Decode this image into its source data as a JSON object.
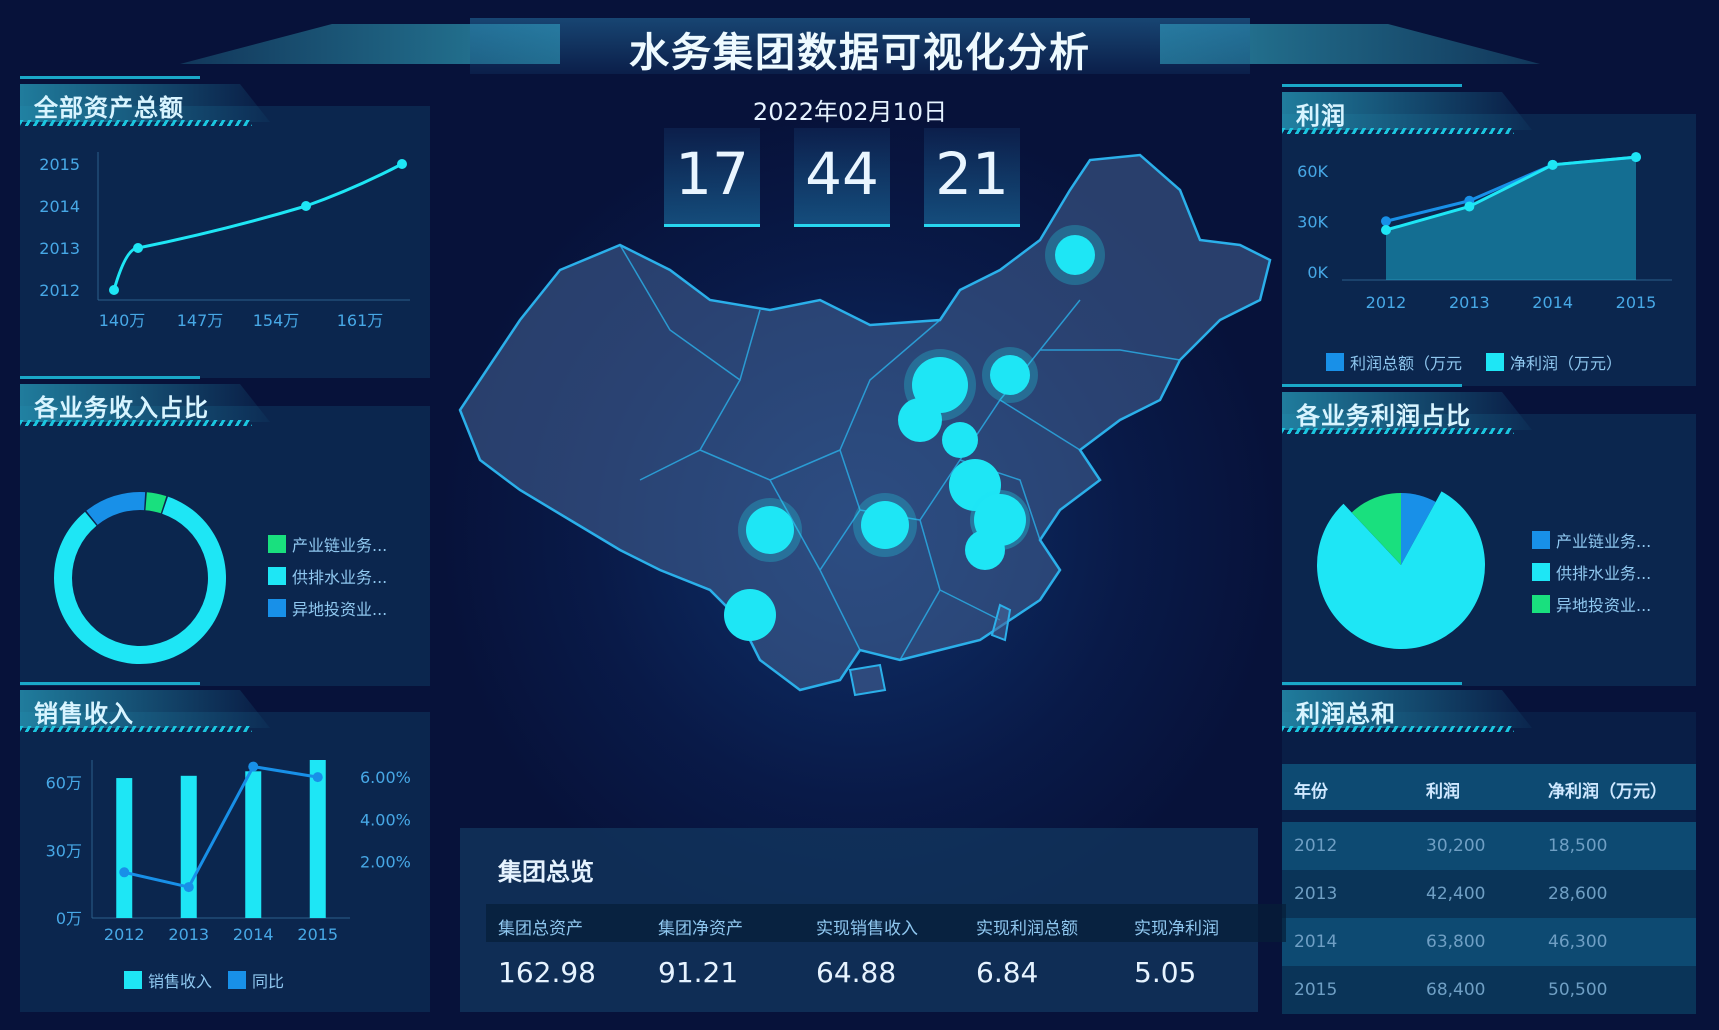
{
  "header": {
    "title": "水务集团数据可视化分析"
  },
  "datetime": {
    "date": "2022年02月10日",
    "hour": "17",
    "minute": "44",
    "second": "21"
  },
  "colors": {
    "bg": "#07123a",
    "cyan": "#1ee6f5",
    "blue": "#1890e8",
    "green": "#19e07e"
  },
  "assets": {
    "title": "全部资产总额",
    "chart_data": {
      "type": "line",
      "x_ticks": [
        "140万",
        "147万",
        "154万",
        "161万"
      ],
      "y_ticks": [
        "2015",
        "2014",
        "2013",
        "2012"
      ],
      "points": [
        {
          "x": 140,
          "y": 2012
        },
        {
          "x": 142,
          "y": 2013
        },
        {
          "x": 156,
          "y": 2014
        },
        {
          "x": 164,
          "y": 2015
        }
      ]
    }
  },
  "income_share": {
    "title": "各业务收入占比",
    "chart_data": {
      "type": "pie",
      "slices": [
        {
          "name": "产业链业务...",
          "value": 4
        },
        {
          "name": "供排水业务...",
          "value": 84
        },
        {
          "name": "异地投资业...",
          "value": 12
        }
      ]
    }
  },
  "sales": {
    "title": "销售收入",
    "chart_data": {
      "type": "bar",
      "categories": [
        "2012",
        "2013",
        "2014",
        "2015"
      ],
      "y_ticks_left": [
        "60万",
        "30万",
        "0万"
      ],
      "y_ticks_right": [
        "6.00%",
        "4.00%",
        "2.00%"
      ],
      "series": [
        {
          "name": "销售收入",
          "type": "bar",
          "values": [
            62,
            63,
            65,
            70
          ]
        },
        {
          "name": "同比",
          "type": "line",
          "values": [
            1.5,
            0.8,
            6.5,
            6.0
          ]
        }
      ]
    }
  },
  "profit": {
    "title": "利润",
    "chart_data": {
      "type": "area",
      "categories": [
        "2012",
        "2013",
        "2014",
        "2015"
      ],
      "y_ticks": [
        "60K",
        "30K",
        "0K"
      ],
      "series": [
        {
          "name": "利润总额（万元",
          "values": [
            30200,
            42400,
            63800,
            68400
          ]
        },
        {
          "name": "净利润（万元）",
          "values": [
            25000,
            39000,
            63800,
            68400
          ]
        }
      ]
    }
  },
  "profit_share": {
    "title": "各业务利润占比",
    "chart_data": {
      "type": "pie",
      "slices": [
        {
          "name": "产业链业务...",
          "value": 8
        },
        {
          "name": "供排水业务...",
          "value": 80
        },
        {
          "name": "异地投资业...",
          "value": 12
        }
      ]
    }
  },
  "profit_total": {
    "title": "利润总和",
    "headers": [
      "年份",
      "利润",
      "净利润（万元）"
    ],
    "rows": [
      [
        "2012",
        "30,200",
        "18,500"
      ],
      [
        "2013",
        "42,400",
        "28,600"
      ],
      [
        "2014",
        "63,800",
        "46,300"
      ],
      [
        "2015",
        "68,400",
        "50,500"
      ]
    ]
  },
  "overview": {
    "title": "集团总览",
    "labels": [
      "集团总资产",
      "集团净资产",
      "实现销售收入",
      "实现利润总额",
      "实现净利润"
    ],
    "values": [
      "162.98",
      "91.21",
      "64.88",
      "6.84",
      "5.05"
    ]
  }
}
